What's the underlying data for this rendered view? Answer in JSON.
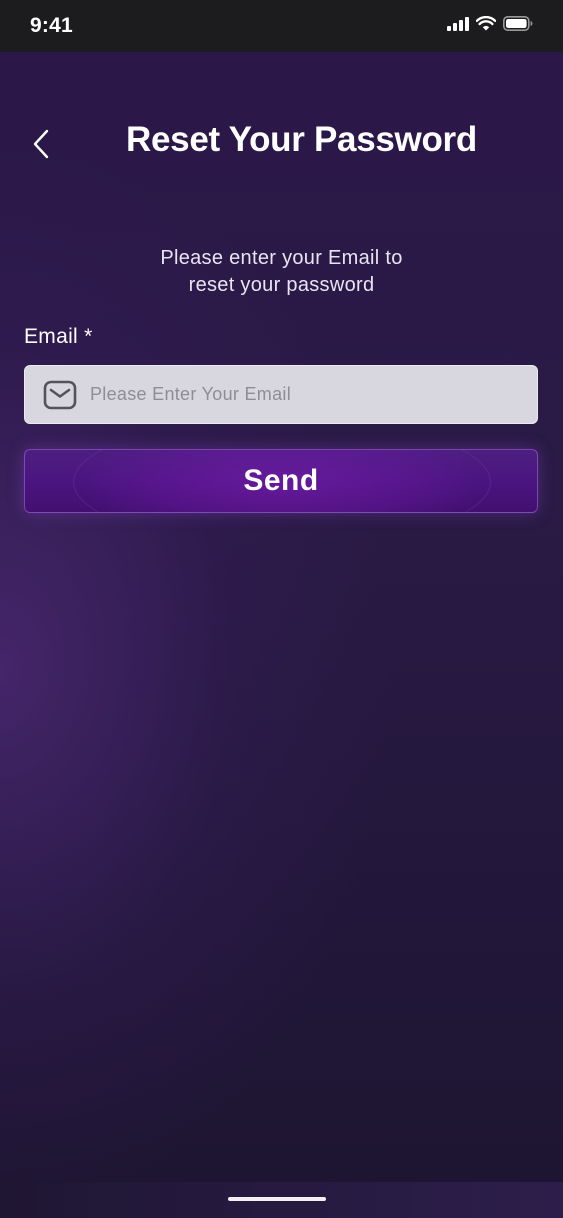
{
  "status_bar": {
    "time": "9:41",
    "icons": [
      "cellular-signal-icon",
      "wifi-icon",
      "battery-icon"
    ]
  },
  "header": {
    "back_icon": "chevron-left-icon",
    "title": "Reset Your Password"
  },
  "form": {
    "instructions": "Please enter your Email to\nreset your password",
    "email_label": "Email *",
    "email_icon": "mail-icon",
    "email_placeholder": "Please Enter Your Email",
    "email_value": "",
    "send_label": "Send"
  },
  "colors": {
    "background_top": "#2b1849",
    "background_bottom": "#1e1532",
    "input_background": "#d8d6de",
    "button_primary": "#4a1580",
    "text_primary": "#ffffff"
  }
}
